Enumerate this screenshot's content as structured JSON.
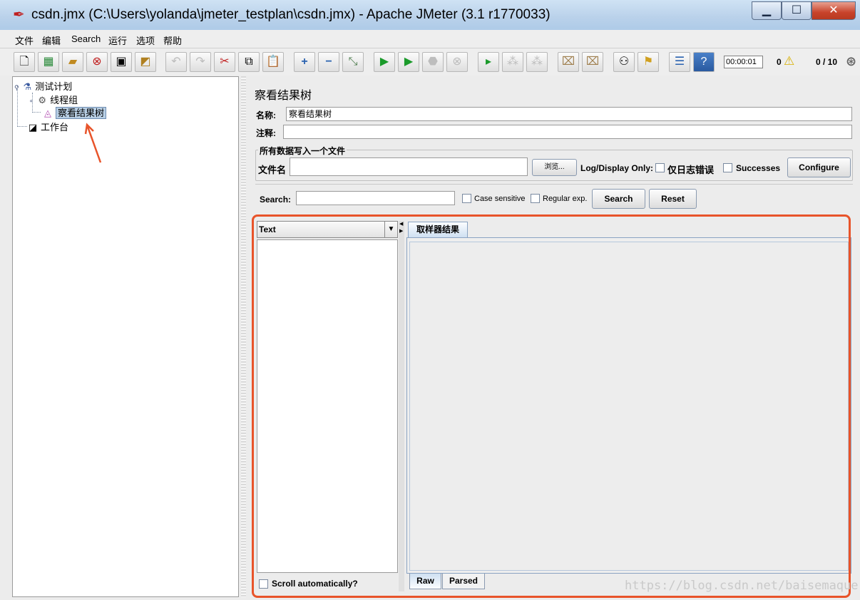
{
  "window": {
    "title": "csdn.jmx (C:\\Users\\yolanda\\jmeter_testplan\\csdn.jmx) - Apache JMeter (3.1 r1770033)"
  },
  "menu": [
    "文件",
    "编辑",
    "Search",
    "运行",
    "选项",
    "帮助"
  ],
  "toolbar": {
    "timer": "00:00:01",
    "warnings": "0",
    "threads": "0 / 10"
  },
  "tree": {
    "test_plan": "测试计划",
    "thread_group": "线程组",
    "results_tree": "察看结果树",
    "workbench": "工作台"
  },
  "panel": {
    "title": "察看结果树",
    "name_label": "名称:",
    "name_value": "察看结果树",
    "comment_label": "注释:",
    "comment_value": "",
    "group_title": "所有数据写入一个文件",
    "filename_label": "文件名",
    "filename_value": "",
    "browse_button": "浏览...",
    "log_display_only": "Log/Display Only:",
    "errors_only": "仅日志错误",
    "successes": "Successes",
    "configure_button": "Configure"
  },
  "search": {
    "label": "Search:",
    "value": "",
    "case_sensitive": "Case sensitive",
    "regular_exp": "Regular exp.",
    "search_button": "Search",
    "reset_button": "Reset"
  },
  "results": {
    "renderer": "Text",
    "scroll_auto": "Scroll automatically?",
    "tab_sampler": "取样器结果",
    "tab_raw": "Raw",
    "tab_parsed": "Parsed"
  },
  "watermark": "https://blog.csdn.net/baisemaque",
  "colors": {
    "highlight_frame": "#e8542a",
    "selected_node": "#b8cfe5"
  }
}
